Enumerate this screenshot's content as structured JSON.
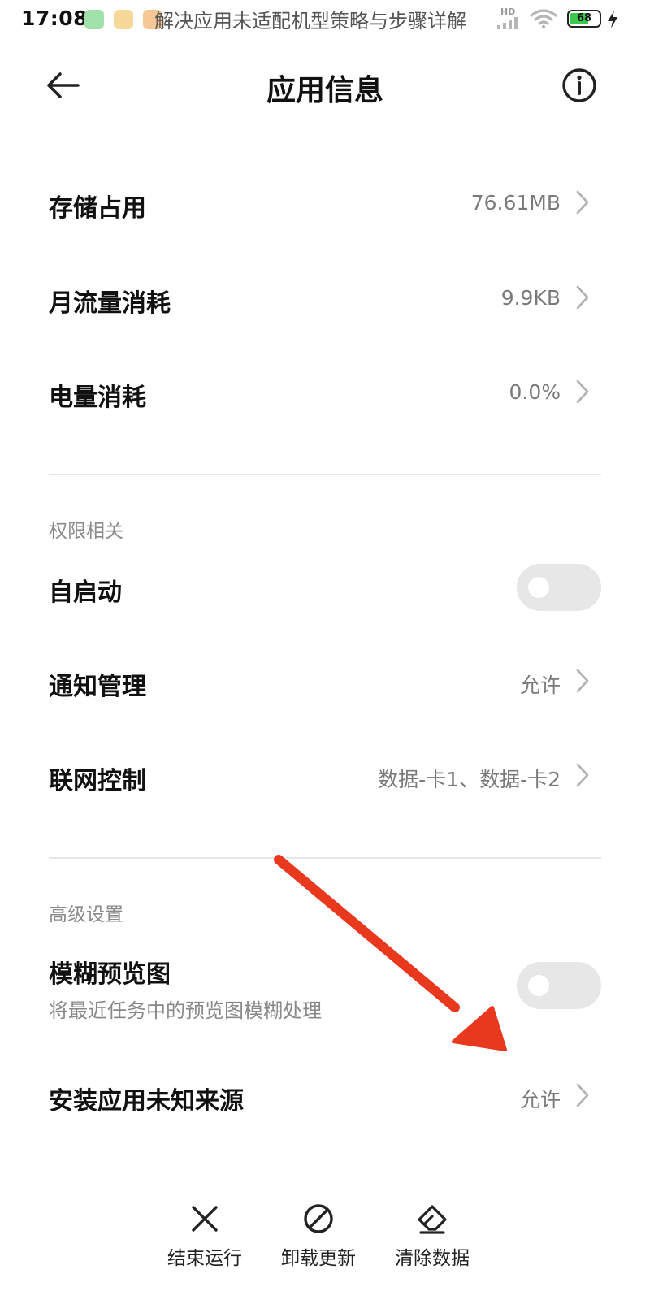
{
  "status_bar": {
    "time": "17:08",
    "watermark": "解决应用未适配机型策略与步骤详解",
    "network_label": "HD",
    "battery_level": "68",
    "battery_percent": 68,
    "battery_color": "#3cc94b"
  },
  "header": {
    "title": "应用信息"
  },
  "usage": [
    {
      "label": "存储占用",
      "value": "76.61MB"
    },
    {
      "label": "月流量消耗",
      "value": "9.9KB"
    },
    {
      "label": "电量消耗",
      "value": "0.0%"
    }
  ],
  "permissions": {
    "title": "权限相关",
    "autostart": {
      "label": "自启动",
      "enabled": false
    },
    "notifications": {
      "label": "通知管理",
      "value": "允许"
    },
    "network": {
      "label": "联网控制",
      "value": "数据-卡1、数据-卡2"
    }
  },
  "advanced": {
    "title": "高级设置",
    "blur": {
      "label": "模糊预览图",
      "description": "将最近任务中的预览图模糊处理",
      "enabled": false
    },
    "unknown_sources": {
      "label": "安装应用未知来源",
      "value": "允许"
    }
  },
  "actions": [
    {
      "label": "结束运行",
      "icon": "close-icon"
    },
    {
      "label": "卸载更新",
      "icon": "prohibit-icon"
    },
    {
      "label": "清除数据",
      "icon": "eraser-icon"
    }
  ],
  "colors": {
    "annotation_arrow": "#e8391f",
    "toggle_off": "#e7e7e7"
  }
}
